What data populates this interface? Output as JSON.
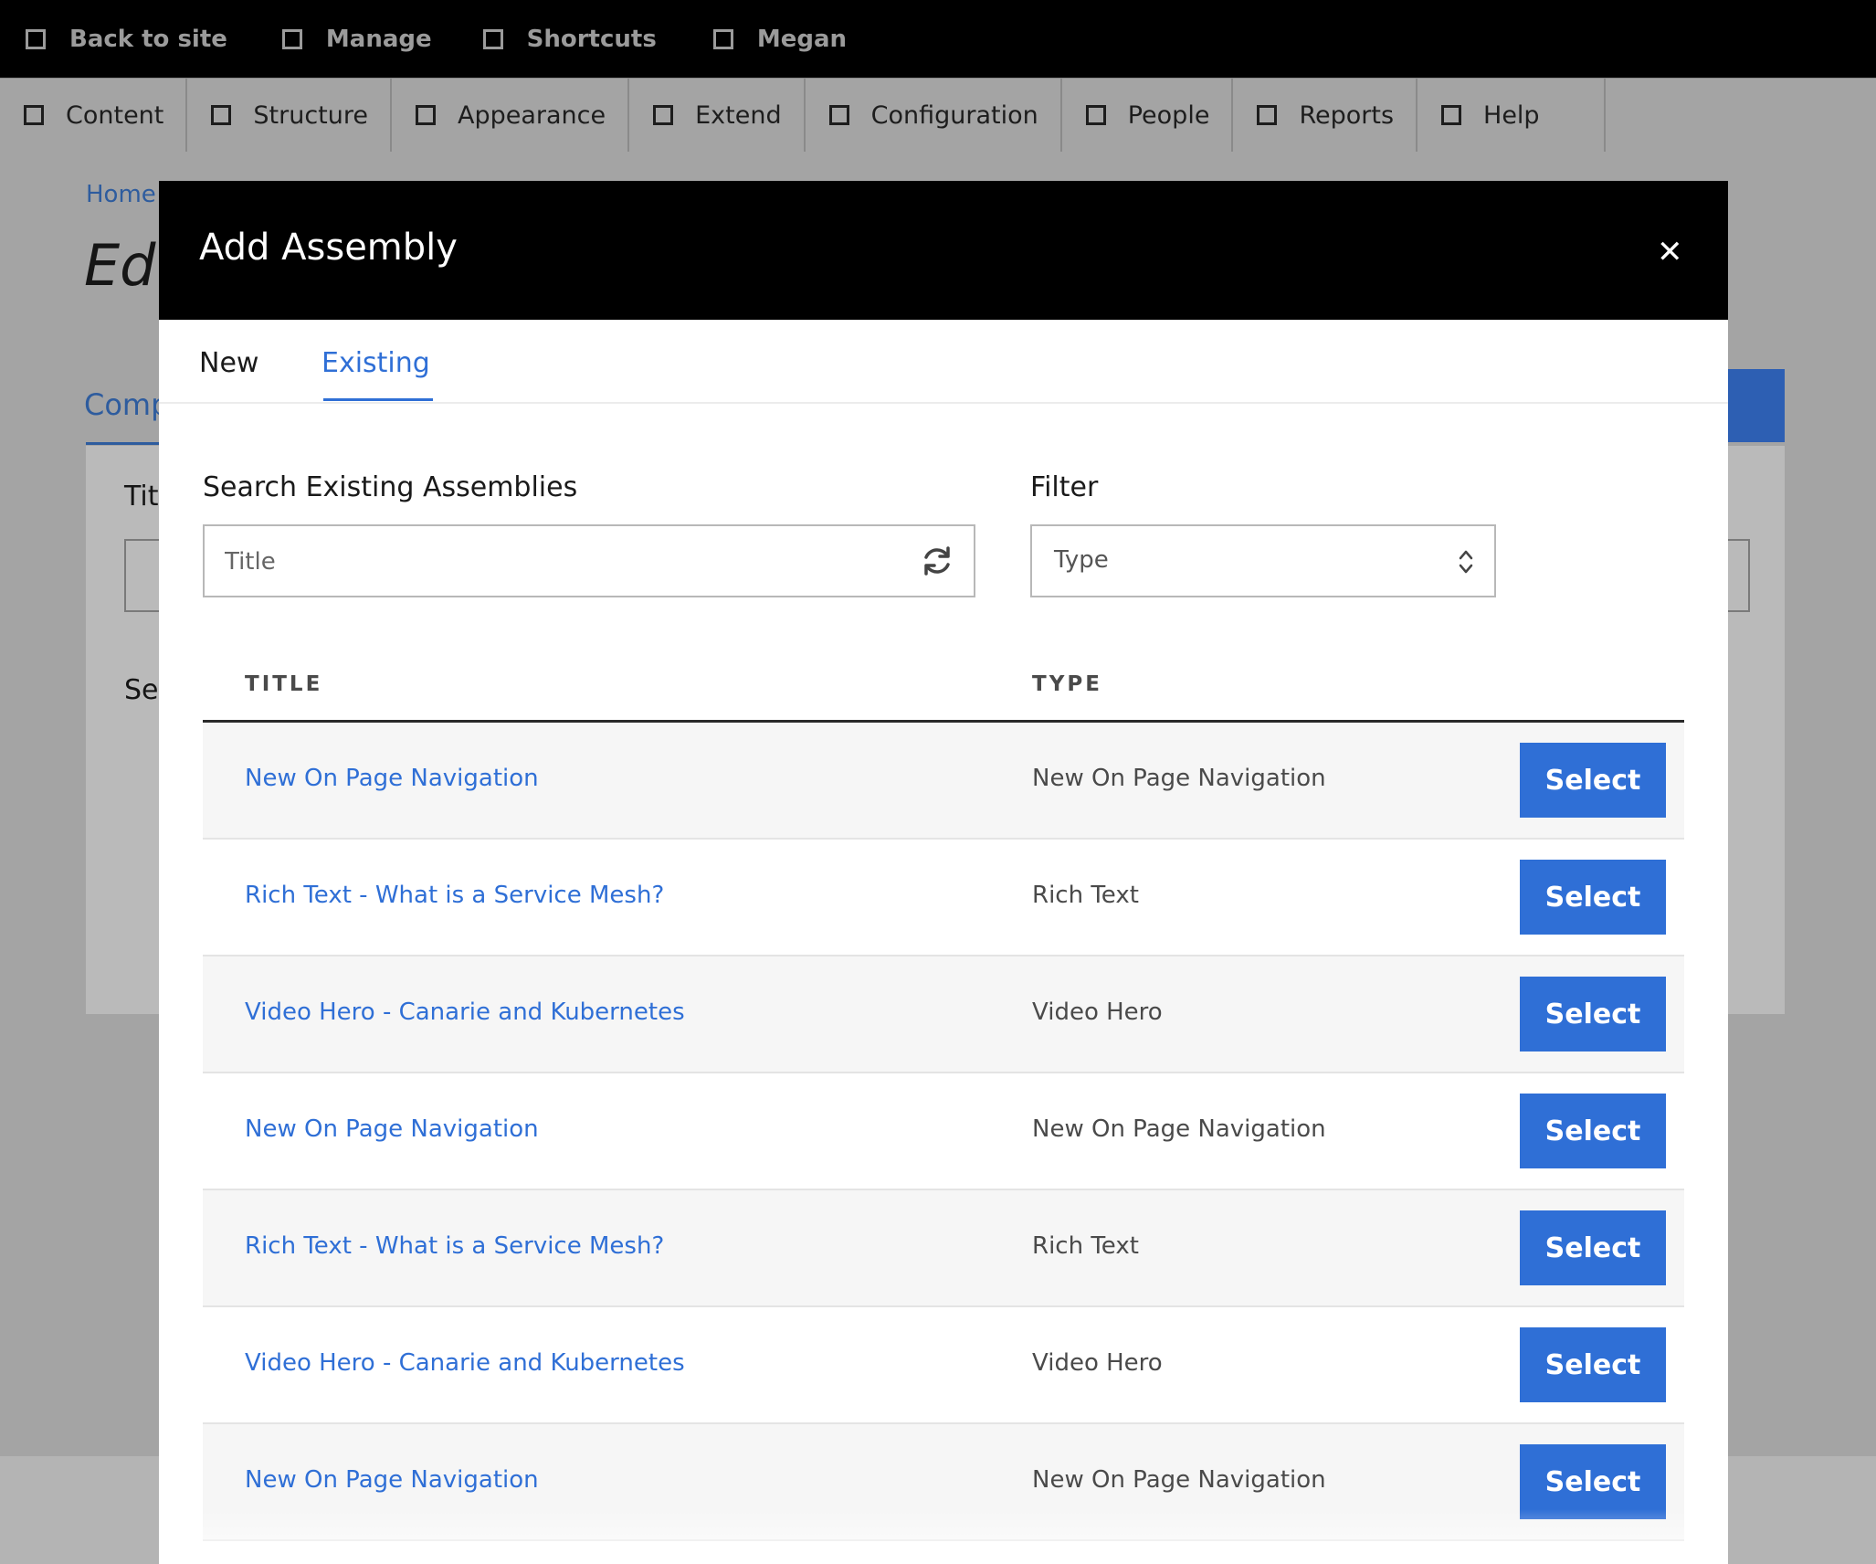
{
  "toolbar": {
    "items": [
      {
        "label": "Back to site",
        "icon": "checkbox-icon"
      },
      {
        "label": "Manage",
        "icon": "checkbox-icon"
      },
      {
        "label": "Shortcuts",
        "icon": "checkbox-icon"
      },
      {
        "label": "Megan",
        "icon": "checkbox-icon"
      }
    ]
  },
  "tray": {
    "items": [
      {
        "label": "Content"
      },
      {
        "label": "Structure"
      },
      {
        "label": "Appearance"
      },
      {
        "label": "Extend"
      },
      {
        "label": "Configuration"
      },
      {
        "label": "People"
      },
      {
        "label": "Reports"
      },
      {
        "label": "Help"
      }
    ]
  },
  "background": {
    "breadcrumb": "Home",
    "title": "Ed",
    "tab": "Comp",
    "label1": "Tit",
    "label2": "Se"
  },
  "modal": {
    "title": "Add Assembly",
    "close_icon": "close-icon",
    "tabs": [
      {
        "label": "New",
        "active": false
      },
      {
        "label": "Existing",
        "active": true
      }
    ],
    "search": {
      "label": "Search Existing Assemblies",
      "placeholder": "Title",
      "icon": "refresh-icon"
    },
    "filter": {
      "label": "Filter",
      "value": "Type",
      "icon": "updown-icon"
    },
    "table": {
      "columns": [
        "TITLE",
        "TYPE"
      ],
      "rows": [
        {
          "title": "New On Page Navigation",
          "type": "New On Page Navigation",
          "action": "Select"
        },
        {
          "title": "Rich Text - What is a Service Mesh?",
          "type": "Rich Text",
          "action": "Select"
        },
        {
          "title": "Video Hero - Canarie and Kubernetes",
          "type": "Video Hero",
          "action": "Select"
        },
        {
          "title": "New On Page Navigation",
          "type": "New On Page Navigation",
          "action": "Select"
        },
        {
          "title": "Rich Text - What is a Service Mesh?",
          "type": "Rich Text",
          "action": "Select"
        },
        {
          "title": "Video Hero - Canarie and Kubernetes",
          "type": "Video Hero",
          "action": "Select"
        },
        {
          "title": "New On Page Navigation",
          "type": "New On Page Navigation",
          "action": "Select"
        }
      ]
    }
  },
  "colors": {
    "accent": "#2f6fd6",
    "toolbar_bg": "#000000",
    "tray_bg": "#a4a4a4"
  }
}
